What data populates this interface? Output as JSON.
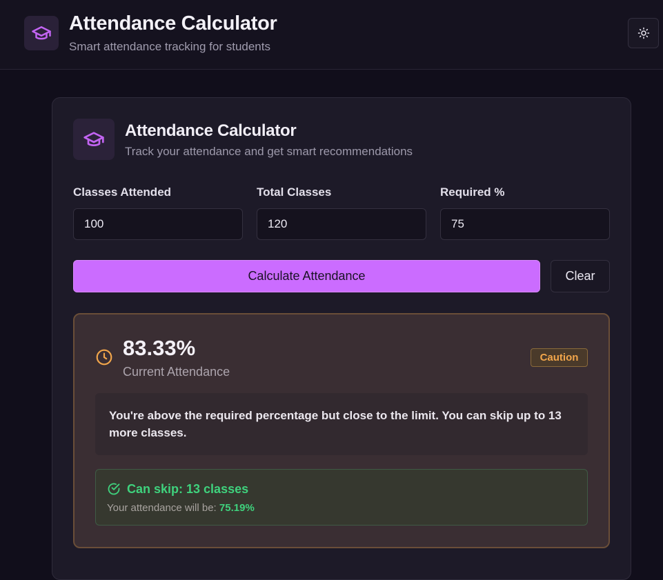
{
  "header": {
    "title": "Attendance Calculator",
    "subtitle": "Smart attendance tracking for students",
    "logo_icon": "graduation-cap-icon",
    "theme_icon": "sun-icon"
  },
  "card": {
    "title": "Attendance Calculator",
    "subtitle": "Track your attendance and get smart recommendations",
    "icon": "graduation-cap-icon"
  },
  "form": {
    "attended_label": "Classes Attended",
    "attended_value": "100",
    "total_label": "Total Classes",
    "total_value": "120",
    "required_label": "Required %",
    "required_value": "75",
    "calculate_label": "Calculate Attendance",
    "clear_label": "Clear"
  },
  "result": {
    "percentage": "83.33%",
    "percentage_label": "Current Attendance",
    "status_badge": "Caution",
    "message": "You're above the required percentage but close to the limit. You can skip up to 13 more classes.",
    "skip_title": "Can skip: 13 classes",
    "skip_prefix": "Your attendance will be:",
    "skip_value": "75.19%"
  },
  "colors": {
    "accent": "#cb6cff",
    "caution": "#f2a64b",
    "success": "#3fd27d",
    "background": "#110e1b"
  }
}
